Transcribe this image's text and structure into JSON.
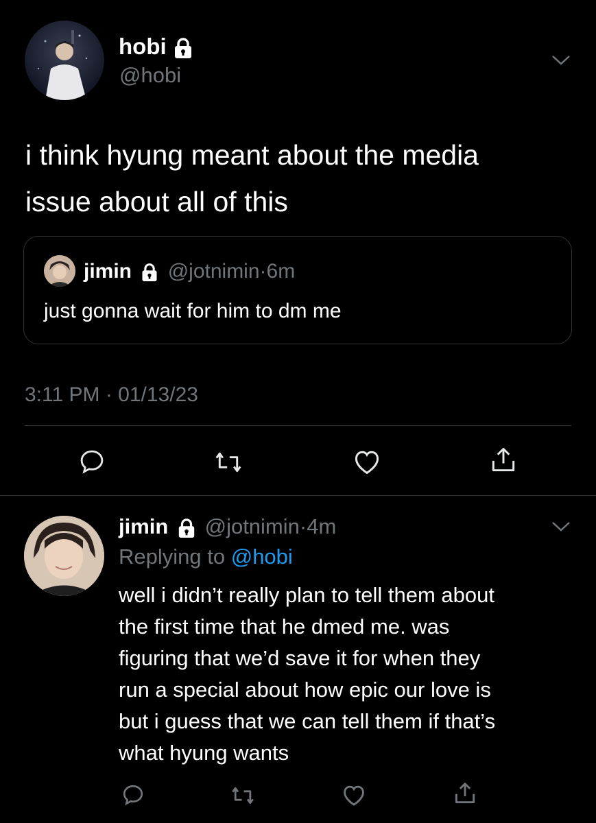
{
  "main_tweet": {
    "author_name": "hobi",
    "author_handle": "@hobi",
    "text_lines": [
      "i think hyung meant about the media",
      "issue about all of this"
    ],
    "quote": {
      "author_name": "jimin",
      "author_handle": "@jotnimin",
      "separator": "·",
      "time_ago": "6m",
      "text": "just gonna wait for him to dm me"
    },
    "timestamp": "3:11 PM · 01/13/23"
  },
  "reply_tweet": {
    "author_name": "jimin",
    "author_handle": "@jotnimin",
    "separator": "·",
    "time_ago": "4m",
    "replying_label": "Replying to",
    "replying_handle": "@hobi",
    "text_lines": [
      "well i didn’t really plan to tell them about",
      "the first time that he dmed me. was",
      "figuring that we’d save it for when they",
      "run a special about how epic our love is",
      "but i guess that we can tell them if that’s",
      "what hyung wants"
    ]
  },
  "colors": {
    "background": "#000000",
    "text": "#e7e9ea",
    "dim": "#71767b",
    "link": "#1d9bf0",
    "border": "#2f3336"
  },
  "icons": [
    "chevron-down-icon",
    "lock-icon",
    "reply-icon",
    "retweet-icon",
    "like-icon",
    "share-icon"
  ]
}
